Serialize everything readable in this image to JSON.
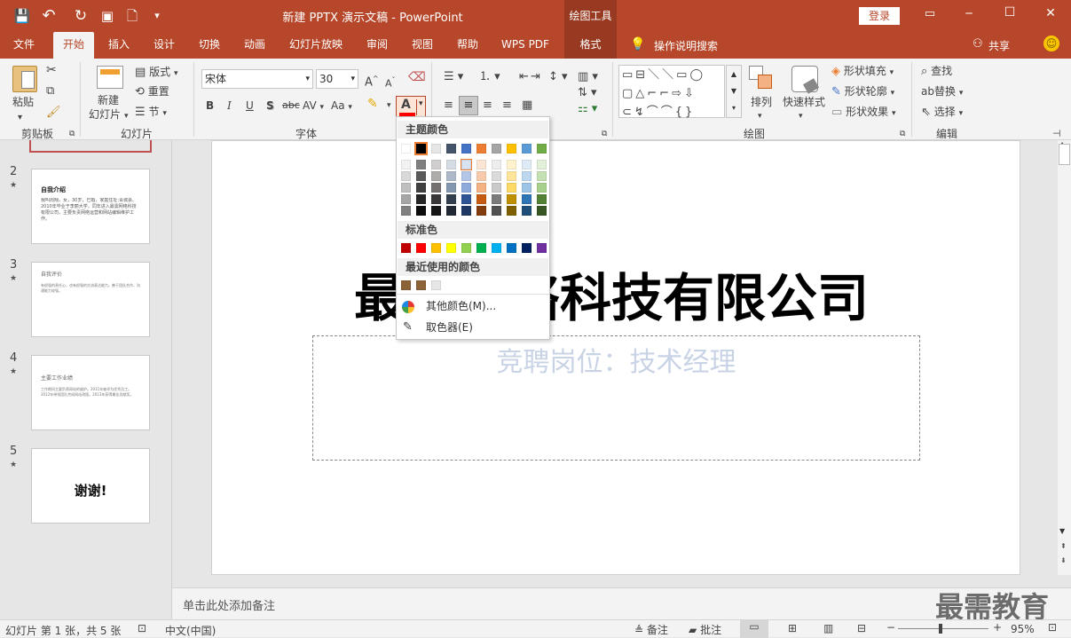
{
  "titlebar": {
    "title": "新建 PPTX 演示文稿 - PowerPoint",
    "context_tool": "绘图工具",
    "login_label": "登录",
    "minimize": "─",
    "maximize": "☐",
    "close": "✕"
  },
  "qat": {
    "save": "💾",
    "undo": "↶",
    "redo": "↻",
    "present": "▣",
    "new": "🗋",
    "more": "▾"
  },
  "tabs": [
    {
      "label": "文件"
    },
    {
      "label": "开始"
    },
    {
      "label": "插入"
    },
    {
      "label": "设计"
    },
    {
      "label": "切换"
    },
    {
      "label": "动画"
    },
    {
      "label": "幻灯片放映"
    },
    {
      "label": "审阅"
    },
    {
      "label": "视图"
    },
    {
      "label": "帮助"
    },
    {
      "label": "WPS PDF"
    },
    {
      "label": "格式"
    }
  ],
  "tell_me": "操作说明搜索",
  "share": "共享",
  "ribbon": {
    "clipboard": {
      "paste": "粘贴",
      "label": "剪贴板"
    },
    "slides": {
      "new_slide_1": "新建",
      "new_slide_2": "幻灯片",
      "layout": "版式",
      "reset": "重置",
      "section": "节",
      "label": "幻灯片"
    },
    "font": {
      "name": "宋体",
      "size": "30",
      "bold": "B",
      "italic": "I",
      "underline": "U",
      "shadow": "S",
      "strike": "abc",
      "spacing": "AV",
      "case": "Aa",
      "grow": "A",
      "shrink": "A",
      "color": "A",
      "label": "字体"
    },
    "drawing": {
      "arrange": "排列",
      "quick_styles": "快速样式",
      "fill": "形状填充",
      "outline": "形状轮廓",
      "effects": "形状效果",
      "label": "绘图"
    },
    "editing": {
      "find": "查找",
      "replace": "替换",
      "select": "选择",
      "label": "编辑"
    }
  },
  "thumbs": [
    {
      "num": "2",
      "title": "自我介绍",
      "body": "我叫周翔，女，30岁，已婚，家庭住址:青城县。2010年毕业于李丽大学，同年进入最需网络科技有限公司，主要负责网络运营和网站编辑维护工作。"
    },
    {
      "num": "3",
      "title": "自我评价",
      "body": "有很强的责任心，也有很强的交流表达能力。善于团队合作，沟通能力较强。"
    },
    {
      "num": "4",
      "title": "主要工作业绩",
      "body": "工作期间主要负责网站的维护。2011年被评为优秀员工。2012年带领团队完成网站改版。2013年获得最佳贡献奖。"
    },
    {
      "num": "5",
      "title": "谢谢!",
      "body": ""
    }
  ],
  "slide": {
    "title": "最需网络科技有限公司",
    "subtitle": "竞聘岗位：技术经理"
  },
  "notes_placeholder": "单击此处添加备注",
  "watermark": "最需教育",
  "status": {
    "slide_info": "幻灯片 第 1 张，共 5 张",
    "language": "中文(中国)",
    "notes": "备注",
    "comments": "批注",
    "zoom": "95%"
  },
  "color_popup": {
    "theme_header": "主题颜色",
    "standard_header": "标准色",
    "recent_header": "最近使用的颜色",
    "more_colors": "其他颜色(M)...",
    "eyedropper": "取色器(E)",
    "theme_top": [
      "#ffffff",
      "#000000",
      "#e7e6e6",
      "#44546a",
      "#4472c4",
      "#ed7d31",
      "#a5a5a5",
      "#ffc000",
      "#5b9bd5",
      "#70ad47"
    ],
    "theme_shades": [
      [
        "#f2f2f2",
        "#d9d9d9",
        "#bfbfbf",
        "#a6a6a6",
        "#808080"
      ],
      [
        "#7f7f7f",
        "#595959",
        "#404040",
        "#262626",
        "#0d0d0d"
      ],
      [
        "#d0cece",
        "#aeabab",
        "#757171",
        "#3a3838",
        "#171616"
      ],
      [
        "#d6dce4",
        "#adb9ca",
        "#8497b0",
        "#333f4f",
        "#222a35"
      ],
      [
        "#d9e2f3",
        "#b4c6e7",
        "#8eaadb",
        "#2f5496",
        "#1f3864"
      ],
      [
        "#fbe5d5",
        "#f7caac",
        "#f4b183",
        "#c55a11",
        "#833c0b"
      ],
      [
        "#ededed",
        "#dbdbdb",
        "#c9c9c9",
        "#7b7b7b",
        "#525252"
      ],
      [
        "#fff2cc",
        "#ffe599",
        "#ffd966",
        "#bf9000",
        "#7f6000"
      ],
      [
        "#deebf6",
        "#bdd7ee",
        "#9dc3e6",
        "#2e75b5",
        "#1f4e79"
      ],
      [
        "#e2efd9",
        "#c5e0b3",
        "#a8d08d",
        "#538135",
        "#375623"
      ]
    ],
    "standard": [
      "#c00000",
      "#ff0000",
      "#ffc000",
      "#ffff00",
      "#92d050",
      "#00b050",
      "#00b0f0",
      "#0070c0",
      "#002060",
      "#7030a0"
    ],
    "recent": [
      "#8c6239",
      "#8c6239",
      "#e7e6e6"
    ]
  }
}
